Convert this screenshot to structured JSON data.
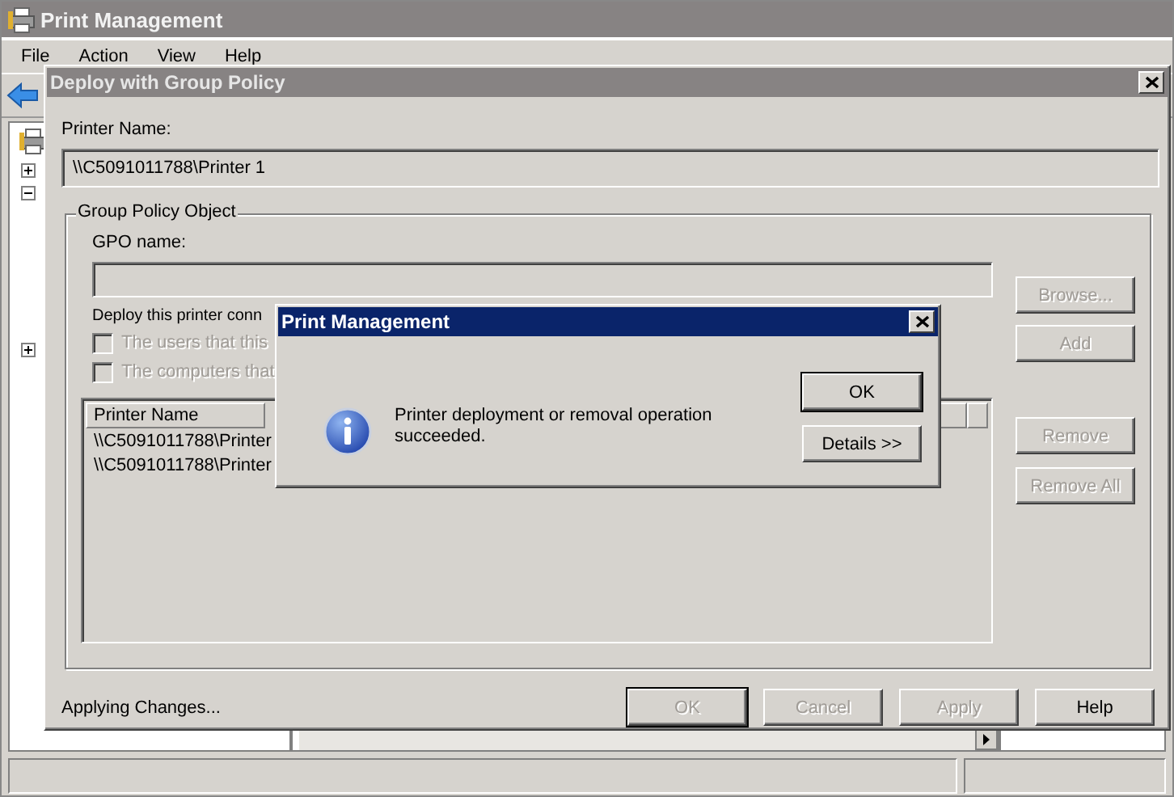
{
  "main_window": {
    "title": "Print Management",
    "menu": [
      "File",
      "Action",
      "View",
      "Help"
    ],
    "tree": {
      "toggles": [
        {
          "expanded": false
        },
        {
          "expanded": true
        },
        {
          "expanded": false
        }
      ]
    }
  },
  "deploy_dialog": {
    "title": "Deploy with Group Policy",
    "printer_name_label": "Printer Name:",
    "printer_name_value": "\\\\C5091011788\\Printer 1",
    "group": {
      "title": "Group Policy Object",
      "gpo_label": "GPO name:",
      "deploy_label": "Deploy this printer conn",
      "checkboxes": [
        {
          "label": "The users that this",
          "checked": false,
          "disabled": true
        },
        {
          "label": "The computers that",
          "checked": false,
          "disabled": true
        }
      ],
      "list": {
        "columns": [
          "Printer Name"
        ],
        "rows": [
          "\\\\C5091011788\\Printer",
          "\\\\C5091011788\\Printer"
        ]
      },
      "side_buttons": [
        {
          "label": "Browse...",
          "disabled": true
        },
        {
          "label": "Add",
          "disabled": true
        },
        {
          "label": "Remove",
          "disabled": true
        },
        {
          "label": "Remove All",
          "disabled": true
        }
      ]
    },
    "status": "Applying Changes...",
    "buttons": [
      {
        "label": "OK",
        "disabled": true,
        "default": true
      },
      {
        "label": "Cancel",
        "disabled": true,
        "default": false
      },
      {
        "label": "Apply",
        "disabled": true,
        "default": false
      },
      {
        "label": "Help",
        "disabled": false,
        "default": false
      }
    ]
  },
  "message_box": {
    "title": "Print Management",
    "message": "Printer deployment or removal operation succeeded.",
    "buttons": [
      {
        "label": "OK",
        "default": true
      },
      {
        "label": "Details >>",
        "default": false
      }
    ]
  }
}
